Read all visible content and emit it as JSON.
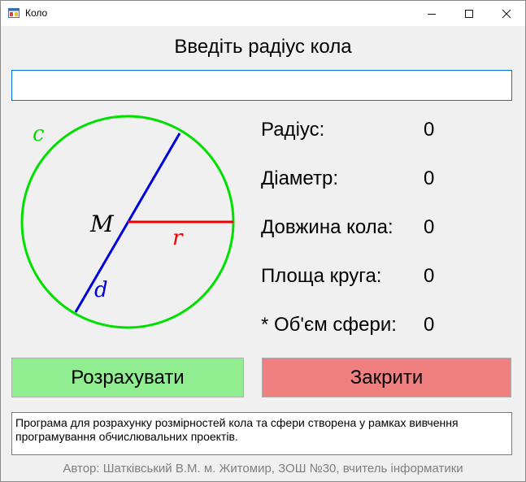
{
  "window": {
    "title": "Коло",
    "app_icon": "windows-form-icon",
    "controls": {
      "minimize": "minimize-icon",
      "maximize": "maximize-icon",
      "close": "close-icon"
    }
  },
  "heading": "Введіть радіус кола",
  "input": {
    "value": "",
    "placeholder": ""
  },
  "diagram": {
    "labels": {
      "circumference": "c",
      "center": "M",
      "radius": "r",
      "diameter": "d"
    },
    "colors": {
      "circle": "#00e000",
      "diameter": "#0000dd",
      "radius": "#ee0000"
    }
  },
  "results": [
    {
      "label": "Радіус:",
      "value": "0"
    },
    {
      "label": "Діаметр:",
      "value": "0"
    },
    {
      "label": "Довжина кола:",
      "value": "0"
    },
    {
      "label": "Площа круга:",
      "value": "0"
    },
    {
      "label": "* Об'єм сфери:",
      "value": "0"
    }
  ],
  "buttons": {
    "calculate": {
      "label": "Розрахувати",
      "color": "#90ee90"
    },
    "close": {
      "label": "Закрити",
      "color": "#f08080"
    }
  },
  "description": "Програма для розрахунку розмірностей кола та сфери створена у рамках вивчення програмування обчислювальних проектів.",
  "author": "Автор: Шатківський В.М. м. Житомир, ЗОШ №30, вчитель інформатики"
}
